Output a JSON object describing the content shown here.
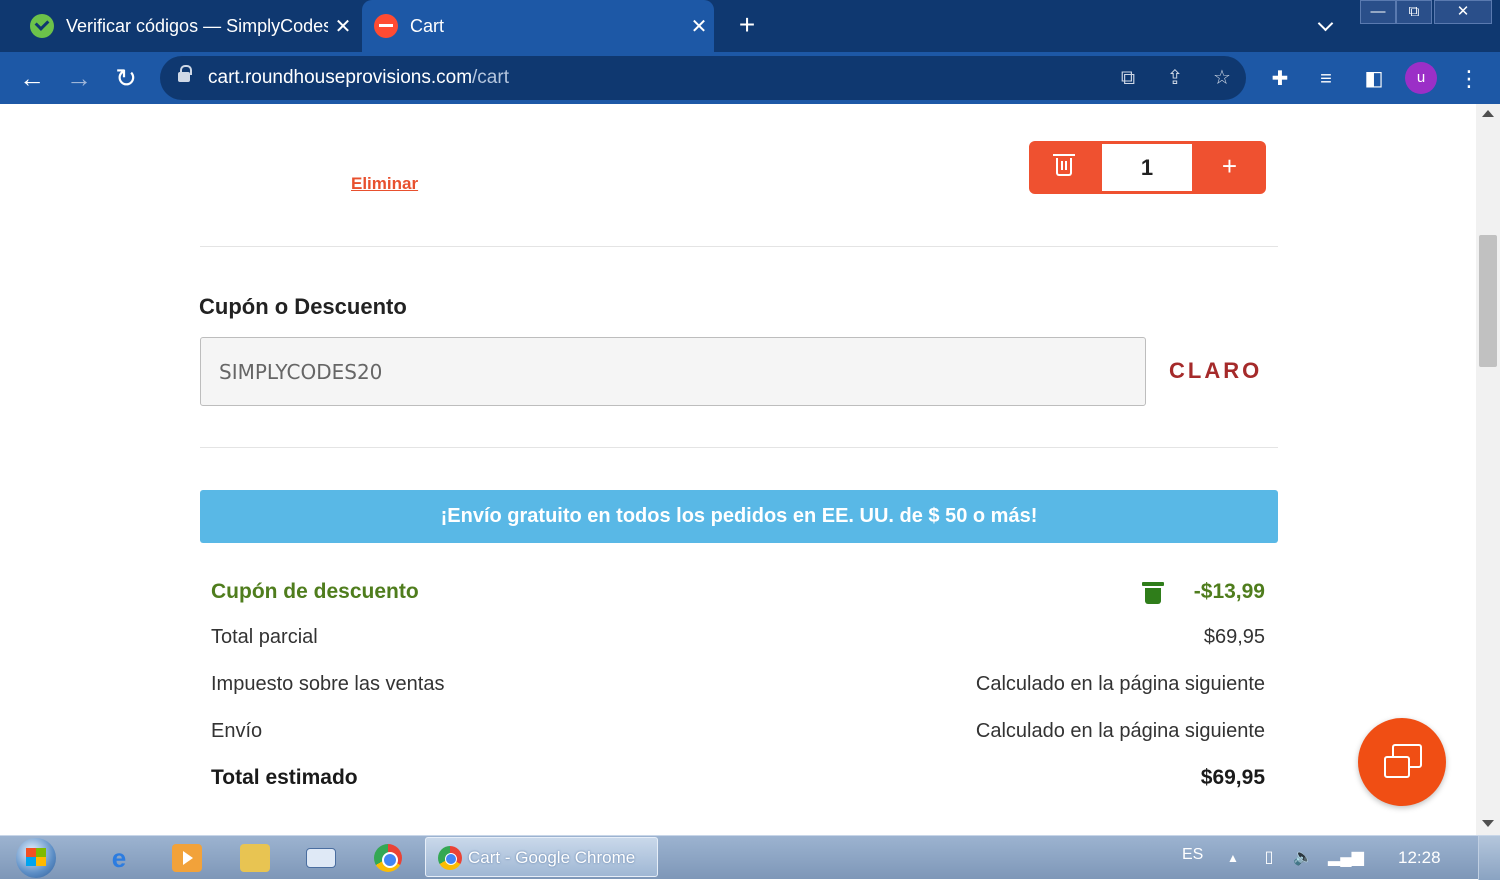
{
  "browser": {
    "tabs": [
      {
        "title": "Verificar códigos — SimplyCodes",
        "favicon": "simplycodes-check-icon",
        "active": false
      },
      {
        "title": "Cart",
        "favicon": "roundhouse-icon",
        "active": true
      }
    ],
    "new_tab_label": "+",
    "window": {
      "minimize": "—",
      "maximize": "⧉",
      "close": "✕"
    },
    "url_host": "cart.roundhouseprovisions.com",
    "url_path": "/cart",
    "profile_initial": "u"
  },
  "cart_item": {
    "remove_label": "Eliminar",
    "quantity": "1",
    "plus_label": "+"
  },
  "coupon": {
    "title": "Cupón o Descuento",
    "code": "SIMPLYCODES20",
    "clear_label": "CLARO"
  },
  "banner": {
    "text": "¡Envío gratuito en todos los pedidos en EE. UU. de $ 50 o más!"
  },
  "summary": {
    "coupon_label": "Cupón de descuento",
    "coupon_value": "-$13,99",
    "subtotal_label": "Total parcial",
    "subtotal_value": "$69,95",
    "tax_label": "Impuesto sobre las ventas",
    "tax_value": "Calculado en la página siguiente",
    "shipping_label": "Envío",
    "shipping_value": "Calculado en la página siguiente",
    "total_label": "Total estimado",
    "total_value": "$69,95"
  },
  "taskbar": {
    "active_window": "Cart - Google Chrome",
    "language": "ES",
    "time": "12:28"
  },
  "colors": {
    "accent_orange": "#ef5130",
    "clear_red": "#a52a2a",
    "banner_blue": "#59b8e6",
    "discount_green": "#4f7d1d",
    "chrome_blue": "#1d58a6"
  }
}
